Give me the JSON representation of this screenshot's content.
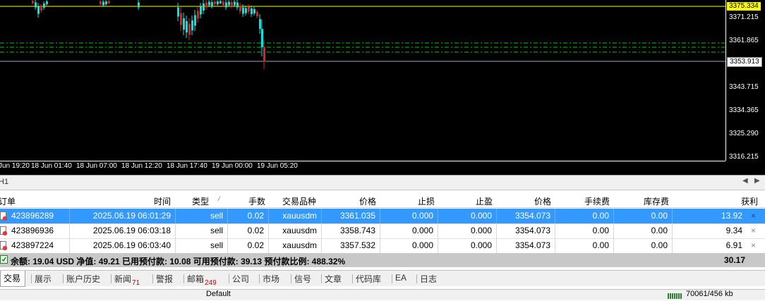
{
  "chart": {
    "price_axis": [
      "3375.334",
      "3371.215",
      "3361.865",
      "3353.913",
      "3343.715",
      "3334.365",
      "3325.290",
      "3316.215"
    ],
    "current_price_tag": "3375.334",
    "bid_price_tag": "3353.913",
    "time_axis": [
      "Jun 19:20",
      "18 Jun 01:40",
      "18 Jun 07:00",
      "18 Jun 12:20",
      "18 Jun 17:40",
      "19 Jun 00:00",
      "19 Jun 05:20"
    ],
    "colors": {
      "background": "#000000",
      "up": "#00e5e5",
      "down": "#e02020",
      "level_line": "#ffff00",
      "order_lines": "#00cc00",
      "bid_line": "#9aa8c8"
    }
  },
  "chart_tab": "H1",
  "table": {
    "headers": [
      "订单",
      "时间",
      "类型",
      "手数",
      "交易品种",
      "价格",
      "止损",
      "止盈",
      "价格",
      "手续费",
      "库存费",
      "获利"
    ],
    "rows": [
      {
        "order": "423896289",
        "time": "2025.06.19 06:01:29",
        "type": "sell",
        "volume": "0.02",
        "symbol": "xauusdm",
        "price": "3361.035",
        "sl": "0.000",
        "tp": "0.000",
        "cur_price": "3354.073",
        "commission": "0.00",
        "swap": "0.00",
        "profit": "13.92",
        "selected": true
      },
      {
        "order": "423896936",
        "time": "2025.06.19 06:03:18",
        "type": "sell",
        "volume": "0.02",
        "symbol": "xauusdm",
        "price": "3358.743",
        "sl": "0.000",
        "tp": "0.000",
        "cur_price": "3354.073",
        "commission": "0.00",
        "swap": "0.00",
        "profit": "9.34",
        "selected": false
      },
      {
        "order": "423897224",
        "time": "2025.06.19 06:03:40",
        "type": "sell",
        "volume": "0.02",
        "symbol": "xauusdm",
        "price": "3357.532",
        "sl": "0.000",
        "tp": "0.000",
        "cur_price": "3354.073",
        "commission": "0.00",
        "swap": "0.00",
        "profit": "6.91",
        "selected": false
      }
    ],
    "close_glyph": "×"
  },
  "summary": {
    "text": "余额: 19.04 USD  净值: 49.21  已用预付款: 10.08  可用预付款: 39.13  预付款比例: 488.32%",
    "total_profit": "30.17"
  },
  "tabs": [
    {
      "label": "交易",
      "badge": ""
    },
    {
      "label": "展示",
      "badge": ""
    },
    {
      "label": "账户历史",
      "badge": ""
    },
    {
      "label": "新闻",
      "badge": "71"
    },
    {
      "label": "警报",
      "badge": ""
    },
    {
      "label": "邮箱",
      "badge": "249"
    },
    {
      "label": "公司",
      "badge": ""
    },
    {
      "label": "市场",
      "badge": ""
    },
    {
      "label": "信号",
      "badge": ""
    },
    {
      "label": "文章",
      "badge": ""
    },
    {
      "label": "代码库",
      "badge": ""
    },
    {
      "label": "EA",
      "badge": ""
    },
    {
      "label": "日志",
      "badge": ""
    }
  ],
  "status": {
    "profile": "Default",
    "traffic": "70061/456 kb"
  }
}
